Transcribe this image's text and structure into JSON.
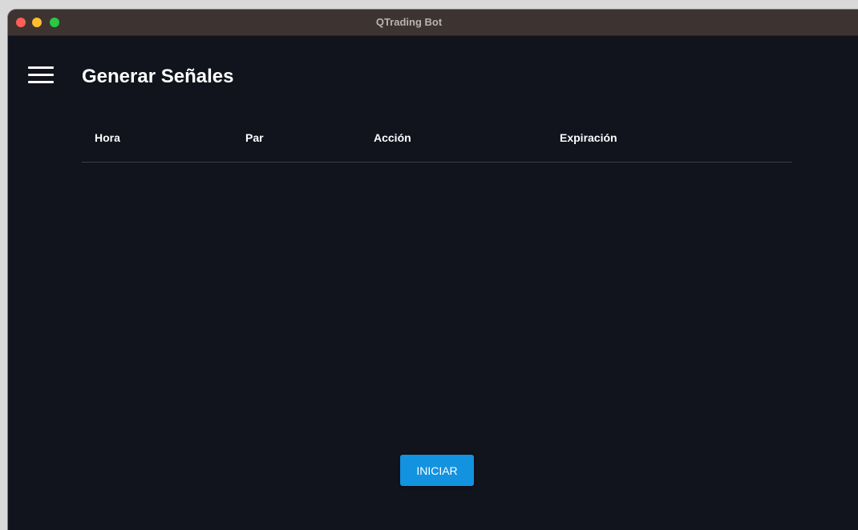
{
  "window": {
    "title": "QTrading Bot"
  },
  "header": {
    "menu_icon": "hamburger-menu-icon",
    "title": "Generar Señales"
  },
  "table": {
    "columns": [
      "Hora",
      "Par",
      "Acción",
      "Expiración"
    ],
    "rows": []
  },
  "actions": {
    "start_label": "INICIAR"
  },
  "colors": {
    "background": "#11131d",
    "titlebar": "#3d3431",
    "accent": "#1392e0",
    "divider": "#3b3f4c"
  }
}
